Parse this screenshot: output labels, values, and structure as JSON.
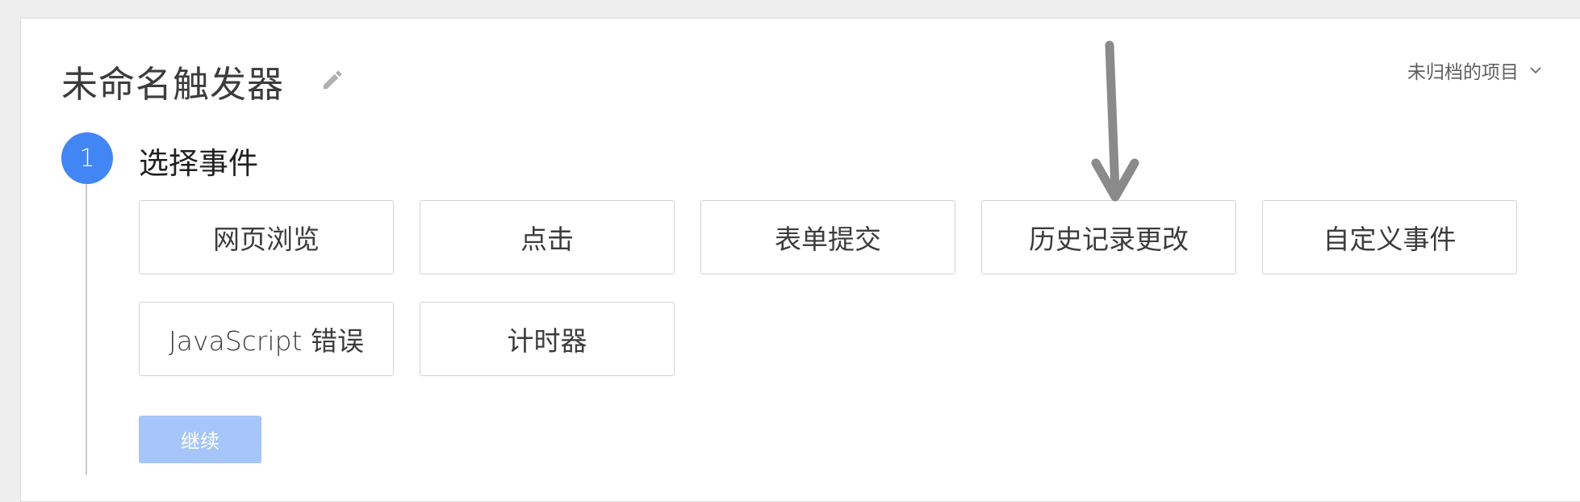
{
  "trigger": {
    "title": "未命名触发器",
    "folder_label": "未归档的项目"
  },
  "step": {
    "number": "1",
    "title": "选择事件"
  },
  "events": [
    {
      "label": "网页浏览"
    },
    {
      "label": "点击"
    },
    {
      "label": "表单提交"
    },
    {
      "label": "历史记录更改"
    },
    {
      "label": "自定义事件"
    },
    {
      "label": "JavaScript 错误"
    },
    {
      "label": "计时器"
    }
  ],
  "continue_label": "继续",
  "colors": {
    "accent": "#4285f4",
    "continue_disabled": "#a6c5f8",
    "annotation_arrow": "#8a8a8a"
  }
}
